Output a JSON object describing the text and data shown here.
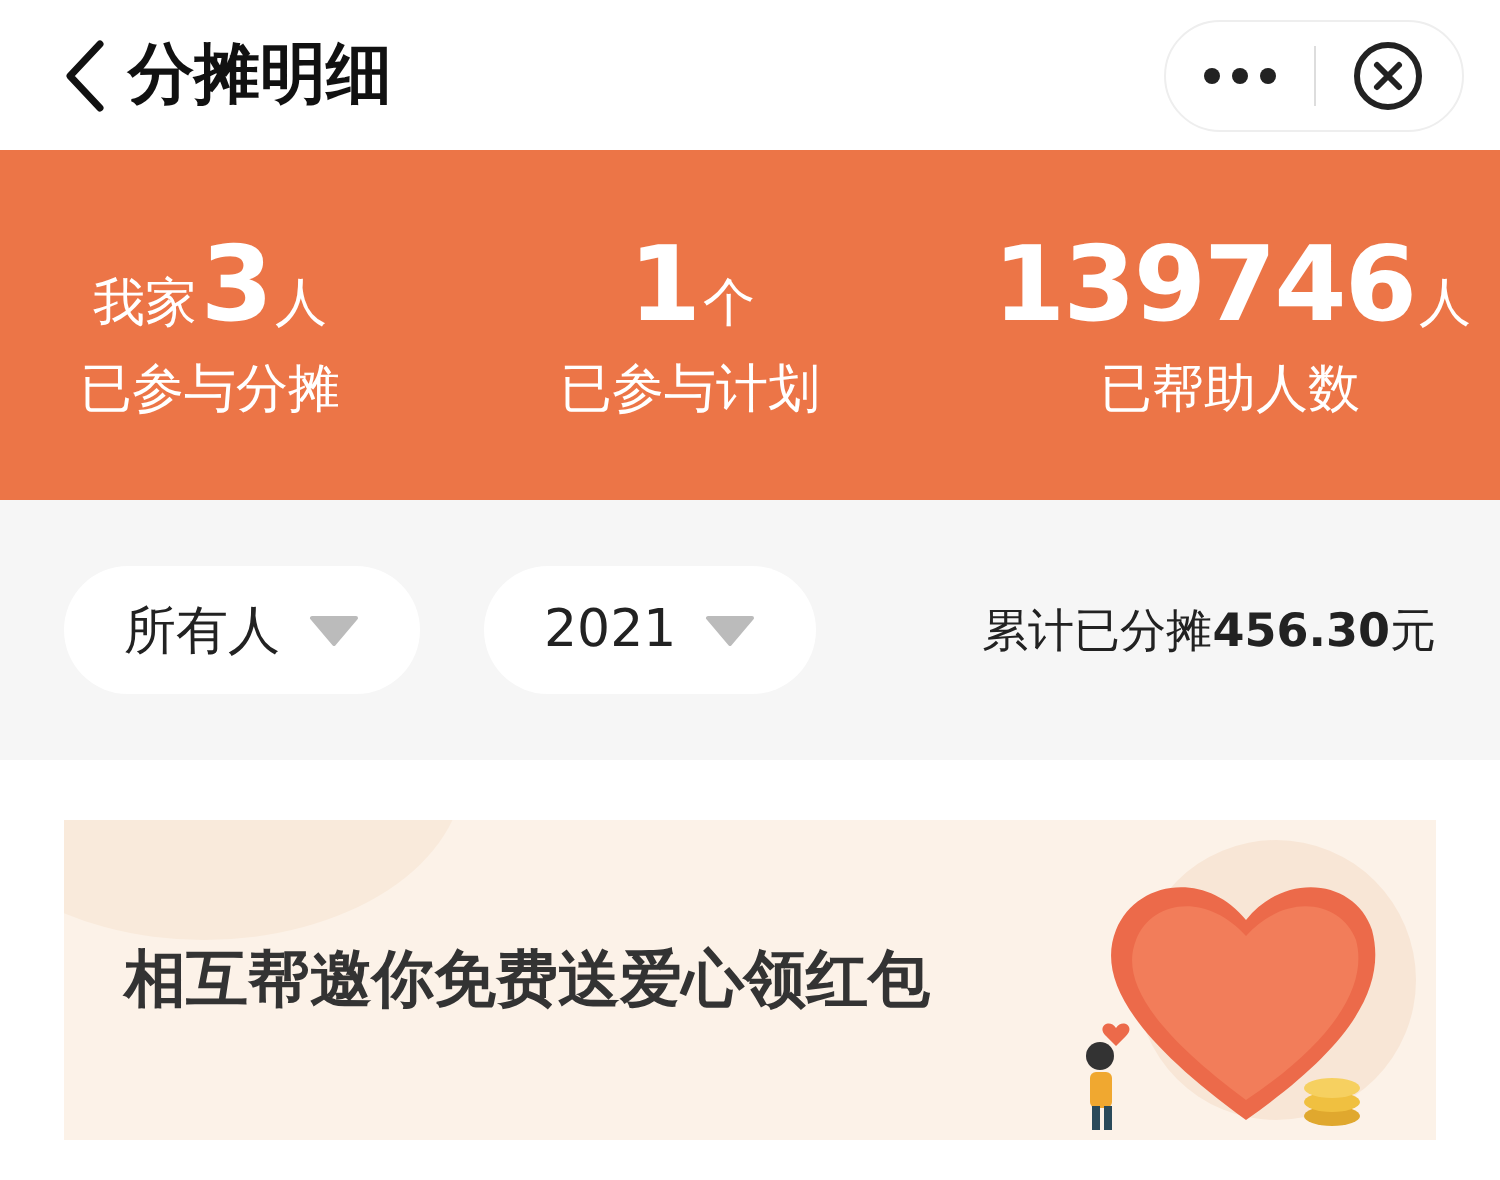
{
  "header": {
    "title": "分摊明细"
  },
  "stats": [
    {
      "prefix": "我家",
      "value": "3",
      "unit": "人",
      "label": "已参与分摊"
    },
    {
      "value": "1",
      "unit": "个",
      "label": "已参与计划"
    },
    {
      "value": "139746",
      "unit": "人",
      "label": "已帮助人数"
    }
  ],
  "filters": [
    {
      "label": "所有人"
    },
    {
      "label": "2021"
    }
  ],
  "total": "累计已分摊**456.30**元",
  "banner": {
    "text": "相互帮邀你免费送爱心领红包"
  }
}
